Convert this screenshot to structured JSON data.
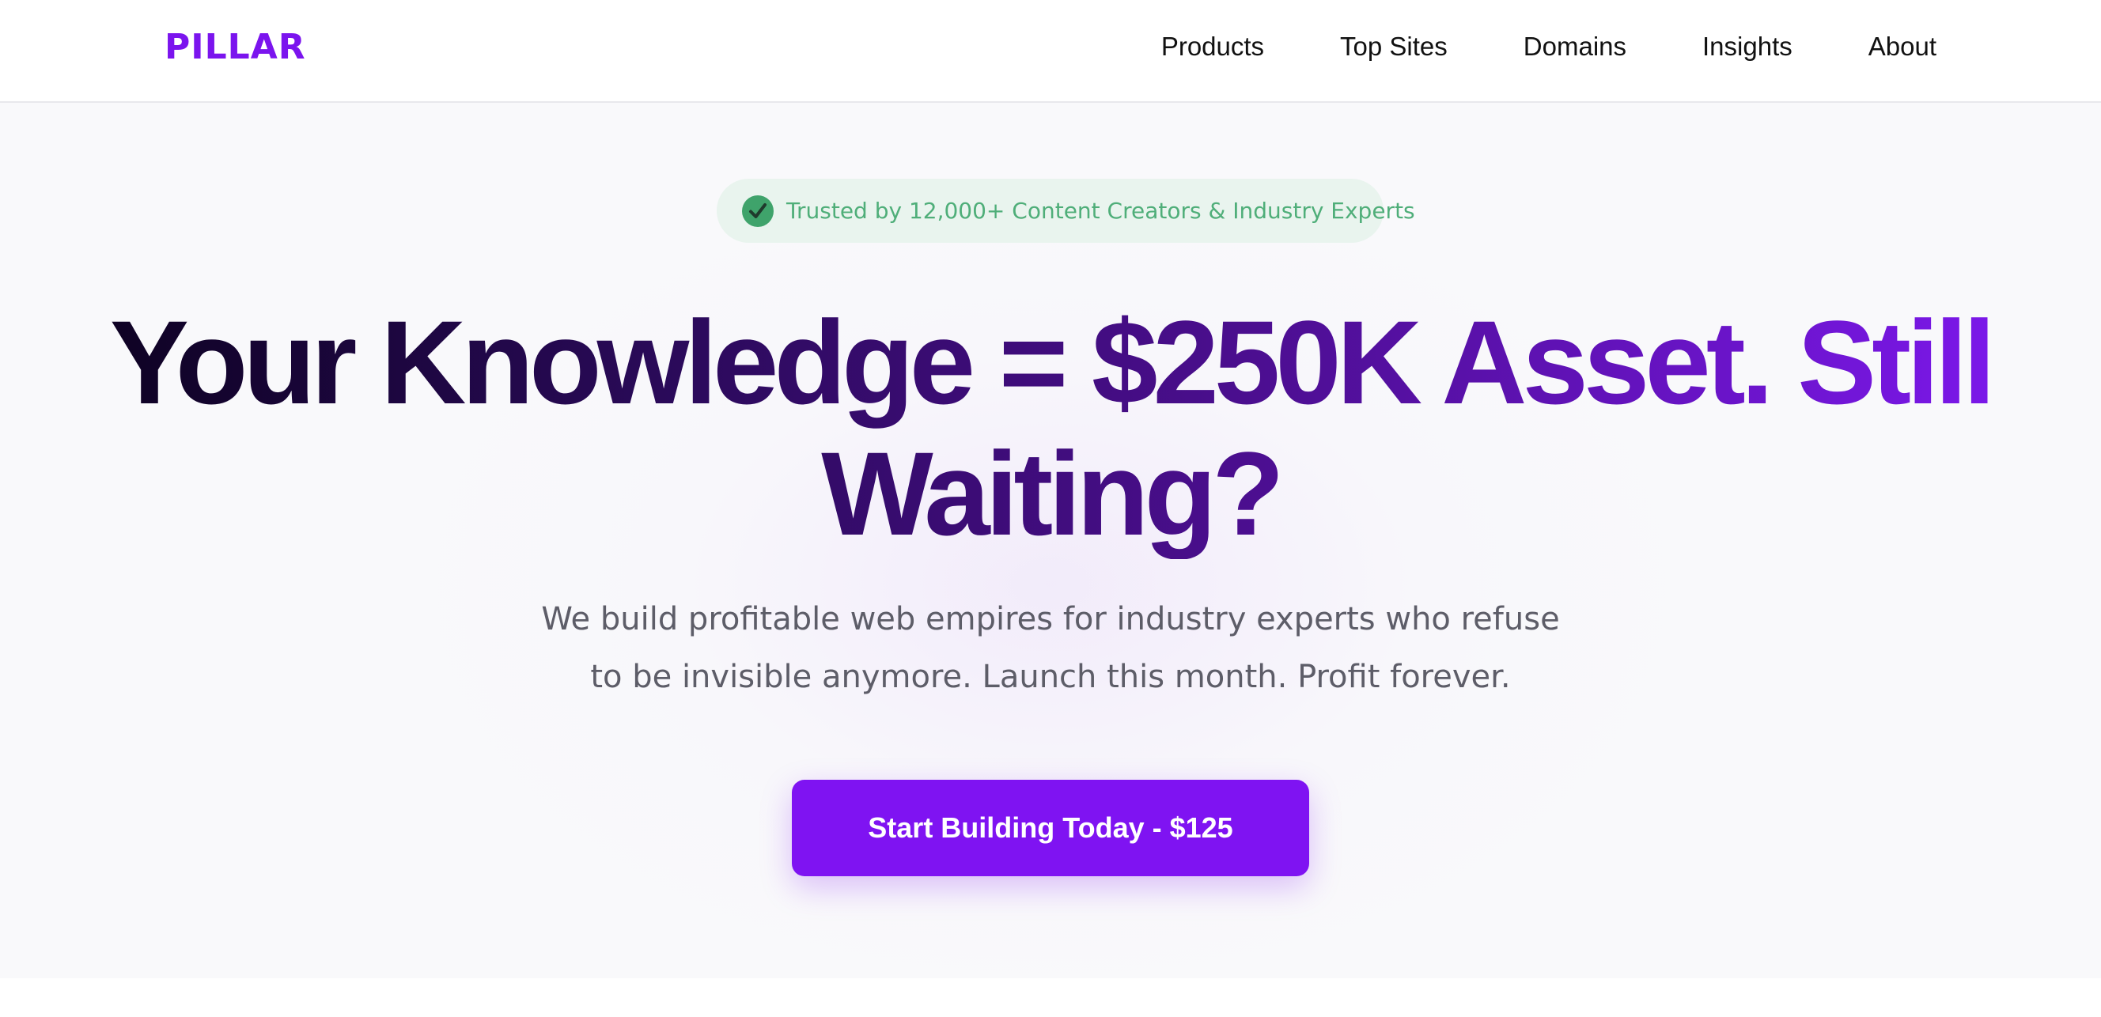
{
  "nav": {
    "logo": "PILLAR",
    "links": [
      "Products",
      "Top Sites",
      "Domains",
      "Insights",
      "About"
    ]
  },
  "hero": {
    "badge": {
      "icon": "check-circle-icon",
      "text": "Trusted by 12,000+ Content Creators & Industry Experts"
    },
    "headline": "Your Knowledge = $250K Asset. Still Waiting?",
    "subtitle": "We build profitable web empires for industry experts who refuse to be invisible anymore. Launch this month. Profit forever.",
    "cta_label": "Start Building Today - $125"
  },
  "colors": {
    "brand": "#7b14ee",
    "cta": "#7f13f2",
    "badge_bg": "#e9f4ee",
    "badge_text": "#4fae79",
    "headline_dark": "#0d0221",
    "headline_purple": "#7d18ec"
  }
}
